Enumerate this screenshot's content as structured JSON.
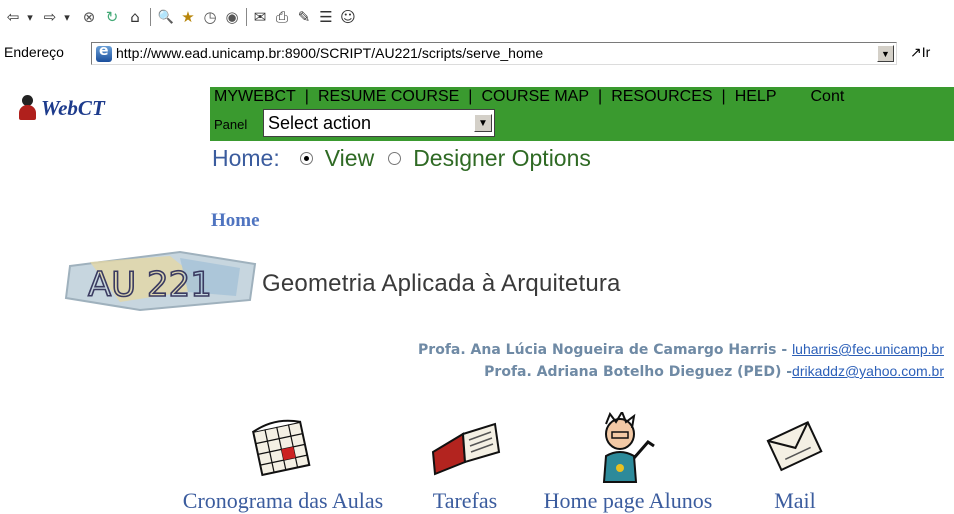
{
  "toolbar": {
    "buttons": [
      {
        "name": "back-arrow-icon",
        "glyph": "⇦"
      },
      {
        "name": "back-dropdown-icon",
        "glyph": "▾"
      },
      {
        "name": "forward-arrow-icon",
        "glyph": "⇨"
      },
      {
        "name": "forward-dropdown-icon",
        "glyph": "▾"
      },
      {
        "name": "stop-icon",
        "glyph": "⊗"
      },
      {
        "name": "refresh-icon",
        "glyph": "↻"
      },
      {
        "name": "home-icon",
        "glyph": "⌂"
      },
      {
        "name": "search-icon",
        "glyph": "🔍"
      },
      {
        "name": "favorites-icon",
        "glyph": "★"
      },
      {
        "name": "history-icon",
        "glyph": "◷"
      },
      {
        "name": "media-icon",
        "glyph": "◉"
      },
      {
        "name": "mail-icon",
        "glyph": "✉"
      },
      {
        "name": "print-icon",
        "glyph": "⎙"
      },
      {
        "name": "edit-icon",
        "glyph": "✎"
      },
      {
        "name": "discuss-icon",
        "glyph": "☰"
      },
      {
        "name": "messenger-icon",
        "glyph": "☺"
      }
    ]
  },
  "address": {
    "label": "Endereço",
    "url": "http://www.ead.unicamp.br:8900/SCRIPT/AU221/scripts/serve_home",
    "go_label": "Ir"
  },
  "logo": {
    "text": "WebCT"
  },
  "nav": {
    "items": [
      "MYWEBCT",
      "RESUME COURSE",
      "COURSE MAP",
      "RESOURCES",
      "HELP"
    ],
    "overflow": "Cont",
    "panel_label": "Panel",
    "select_value": "Select action"
  },
  "home_row": {
    "label": "Home:",
    "options": [
      {
        "label": "View",
        "selected": true
      },
      {
        "label": "Designer Options",
        "selected": false
      }
    ]
  },
  "page": {
    "heading": "Home",
    "banner_graphic_text": "AU 221",
    "banner_title": "Geometria Aplicada à Arquitetura",
    "professors": [
      {
        "text": "Profa. Ana Lúcia Nogueira de Camargo Harris - ",
        "email": "luharris@fec.unicamp.br"
      },
      {
        "text": "Profa. Adriana Botelho Dieguez (PED) -",
        "email": "drikaddz@yahoo.com.br"
      }
    ]
  },
  "tiles": [
    {
      "name": "calendar",
      "label": "Cronograma das Aulas"
    },
    {
      "name": "book",
      "label": "Tarefas"
    },
    {
      "name": "student",
      "label": "Home page Alunos"
    },
    {
      "name": "mail",
      "label": "Mail"
    }
  ],
  "colors": {
    "nav_bg": "#3a9a2f",
    "link_blue": "#3b5c9e",
    "home_green": "#2f6a24"
  }
}
